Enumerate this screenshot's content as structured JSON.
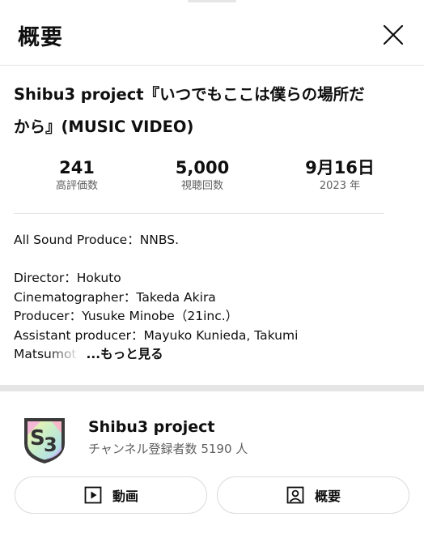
{
  "panel": {
    "title": "概要"
  },
  "video": {
    "title_line1": "Shibu3 project『いつでもここは僕らの場所だ",
    "title_line2": "から』(MUSIC VIDEO)"
  },
  "stats": [
    {
      "value": "241",
      "label": "高評価数"
    },
    {
      "value": "5,000",
      "label": "視聴回数"
    },
    {
      "value": "9月16日",
      "label": "2023 年"
    }
  ],
  "description": {
    "lines": [
      "All Sound Produce：NNBS.",
      "Director：Hokuto",
      "Cinematographer：Takeda Akira",
      "Producer：Yusuke Minobe（21inc.）",
      "Assistant producer：Mayuko Kunieda, Takumi"
    ],
    "truncated_line": "Matsumot",
    "more_label": "...もっと見る"
  },
  "channel": {
    "name": "Shibu3 project",
    "subscribers": "チャンネル登録者数 5190 人",
    "logo_text": "S3"
  },
  "buttons": {
    "videos_label": "動画",
    "about_label": "概要"
  },
  "colors": {
    "text_primary": "#0f0f0f",
    "text_secondary": "#606060",
    "divider": "#e5e5e5",
    "button_border": "#dcdcdc"
  }
}
